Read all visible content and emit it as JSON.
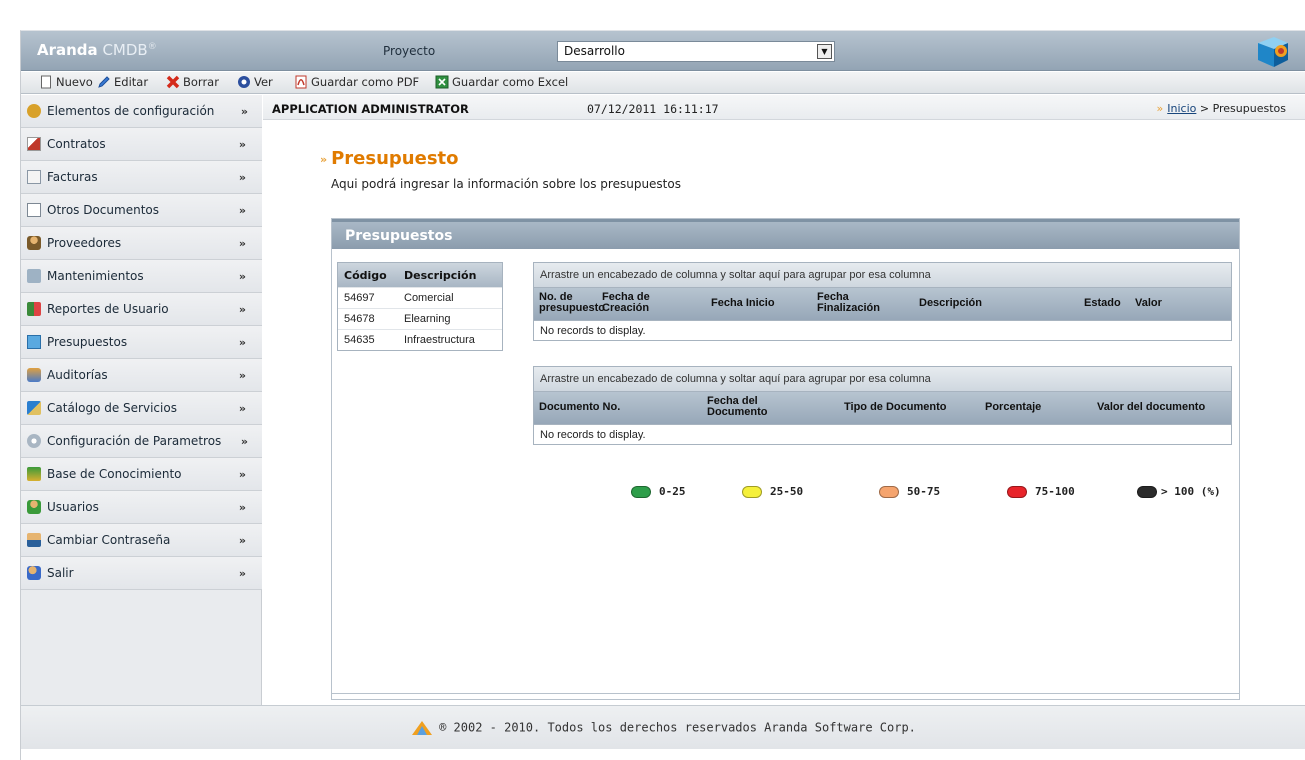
{
  "header": {
    "logo_brand": "Aranda",
    "logo_product": "CMDB",
    "logo_reg": "®",
    "project_label": "Proyecto",
    "project_value": "Desarrollo"
  },
  "toolbar": {
    "new": "Nuevo",
    "edit": "Editar",
    "delete": "Borrar",
    "view": "Ver",
    "save_pdf": "Guardar como PDF",
    "save_excel": "Guardar como Excel"
  },
  "sidebar": {
    "items": [
      {
        "label": "Elementos de configuración",
        "icon": "config-items-icon"
      },
      {
        "label": "Contratos",
        "icon": "contracts-icon"
      },
      {
        "label": "Facturas",
        "icon": "invoices-icon"
      },
      {
        "label": "Otros Documentos",
        "icon": "documents-icon"
      },
      {
        "label": "Proveedores",
        "icon": "providers-icon"
      },
      {
        "label": "Mantenimientos",
        "icon": "maintenance-icon"
      },
      {
        "label": "Reportes de Usuario",
        "icon": "reports-icon"
      },
      {
        "label": "Presupuestos",
        "icon": "budget-icon"
      },
      {
        "label": "Auditorías",
        "icon": "audit-icon"
      },
      {
        "label": "Catálogo de Servicios",
        "icon": "catalog-icon"
      },
      {
        "label": "Configuración de Parametros",
        "icon": "settings-icon"
      },
      {
        "label": "Base de Conocimiento",
        "icon": "knowledge-icon"
      },
      {
        "label": "Usuarios",
        "icon": "users-icon"
      },
      {
        "label": "Cambiar Contraseña",
        "icon": "password-icon"
      },
      {
        "label": "Salir",
        "icon": "exit-icon"
      }
    ]
  },
  "userbar": {
    "username": "APPLICATION ADMINISTRATOR",
    "datetime": "07/12/2011 16:11:17",
    "breadcrumb_link": "Inicio",
    "breadcrumb_current": " > Presupuestos"
  },
  "main": {
    "title": "Presupuesto",
    "description": "Aqui podrá ingresar la información sobre los presupuestos",
    "panel_title": "Presupuestos"
  },
  "code_list": {
    "headers": [
      "Código",
      "Descripción"
    ],
    "rows": [
      [
        "54697",
        "Comercial"
      ],
      [
        "54678",
        "Elearning"
      ],
      [
        "54635",
        "Infraestructura"
      ]
    ]
  },
  "grid1": {
    "group_hint": "Arrastre un encabezado de columna y soltar aquí para agrupar por esa columna",
    "columns": [
      "No. de presupuesto",
      "Fecha de Creación",
      "Fecha Inicio",
      "Fecha Finalización",
      "Descripción",
      "Estado",
      "Valor"
    ],
    "empty": "No records to display."
  },
  "grid2": {
    "group_hint": "Arrastre un encabezado de columna y soltar aquí para agrupar por esa columna",
    "columns": [
      "Documento No.",
      "Fecha del Documento",
      "Tipo de Documento",
      "Porcentaje",
      "Valor del documento"
    ],
    "empty": "No records to display."
  },
  "legend": [
    {
      "label": "0-25",
      "color": "#2e9e4a"
    },
    {
      "label": "25-50",
      "color": "#f5f03a"
    },
    {
      "label": "50-75",
      "color": "#f5a46e"
    },
    {
      "label": "75-100",
      "color": "#e8242a"
    },
    {
      "label": "> 100 (%)",
      "color": "#2b2b2b"
    }
  ],
  "footer": {
    "text": "® 2002 - 2010. Todos los derechos reservados Aranda Software Corp."
  }
}
